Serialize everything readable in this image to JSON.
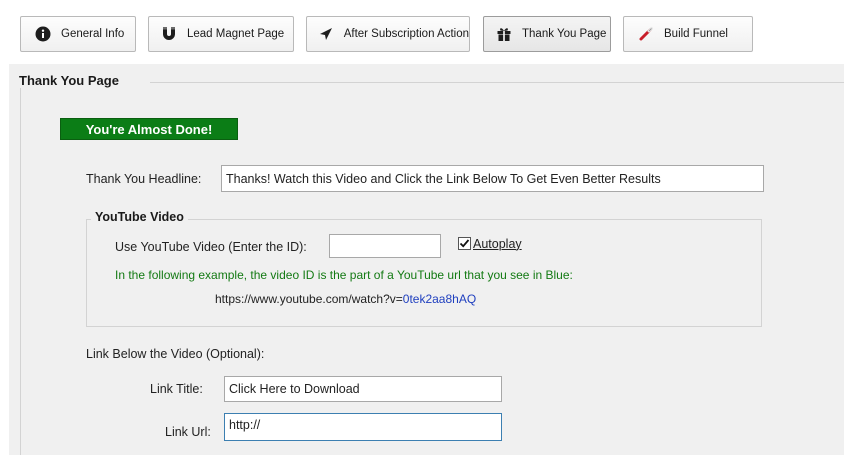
{
  "tabs": [
    {
      "label": "General Info",
      "icon": "info-icon",
      "active": false
    },
    {
      "label": "Lead Magnet Page",
      "icon": "magnet-icon",
      "active": false
    },
    {
      "label": "After Subscription Action",
      "icon": "send-arrow-icon",
      "active": false
    },
    {
      "label": "Thank You Page",
      "icon": "gift-icon",
      "active": true
    },
    {
      "label": "Build Funnel",
      "icon": "magic-wand-icon",
      "active": false
    }
  ],
  "page": {
    "section_title": "Thank You Page",
    "banner": "You're Almost Done!",
    "headline_label": "Thank You Headline:",
    "headline_value": "Thanks! Watch this Video and Click the Link Below To Get Even Better Results"
  },
  "youtube": {
    "title": "YouTube Video",
    "id_label": "Use YouTube Video (Enter the ID):",
    "id_value": "",
    "autoplay_label": "Autoplay",
    "autoplay_checked": true,
    "hint": "In the following example, the video ID is the part of a YouTube url that you see in Blue:",
    "example_prefix": "https://www.youtube.com/watch?v=",
    "example_id": "0tek2aa8hAQ"
  },
  "link": {
    "section_label": "Link Below the Video (Optional):",
    "title_label": "Link Title:",
    "title_value": "Click Here to Download",
    "url_label": "Link Url:",
    "url_value": "http://"
  },
  "colors": {
    "banner_bg": "#0b7d16",
    "hint_text": "#137a13",
    "video_id_blue": "#1f3fbf",
    "focus_border": "#3c7fb1"
  }
}
